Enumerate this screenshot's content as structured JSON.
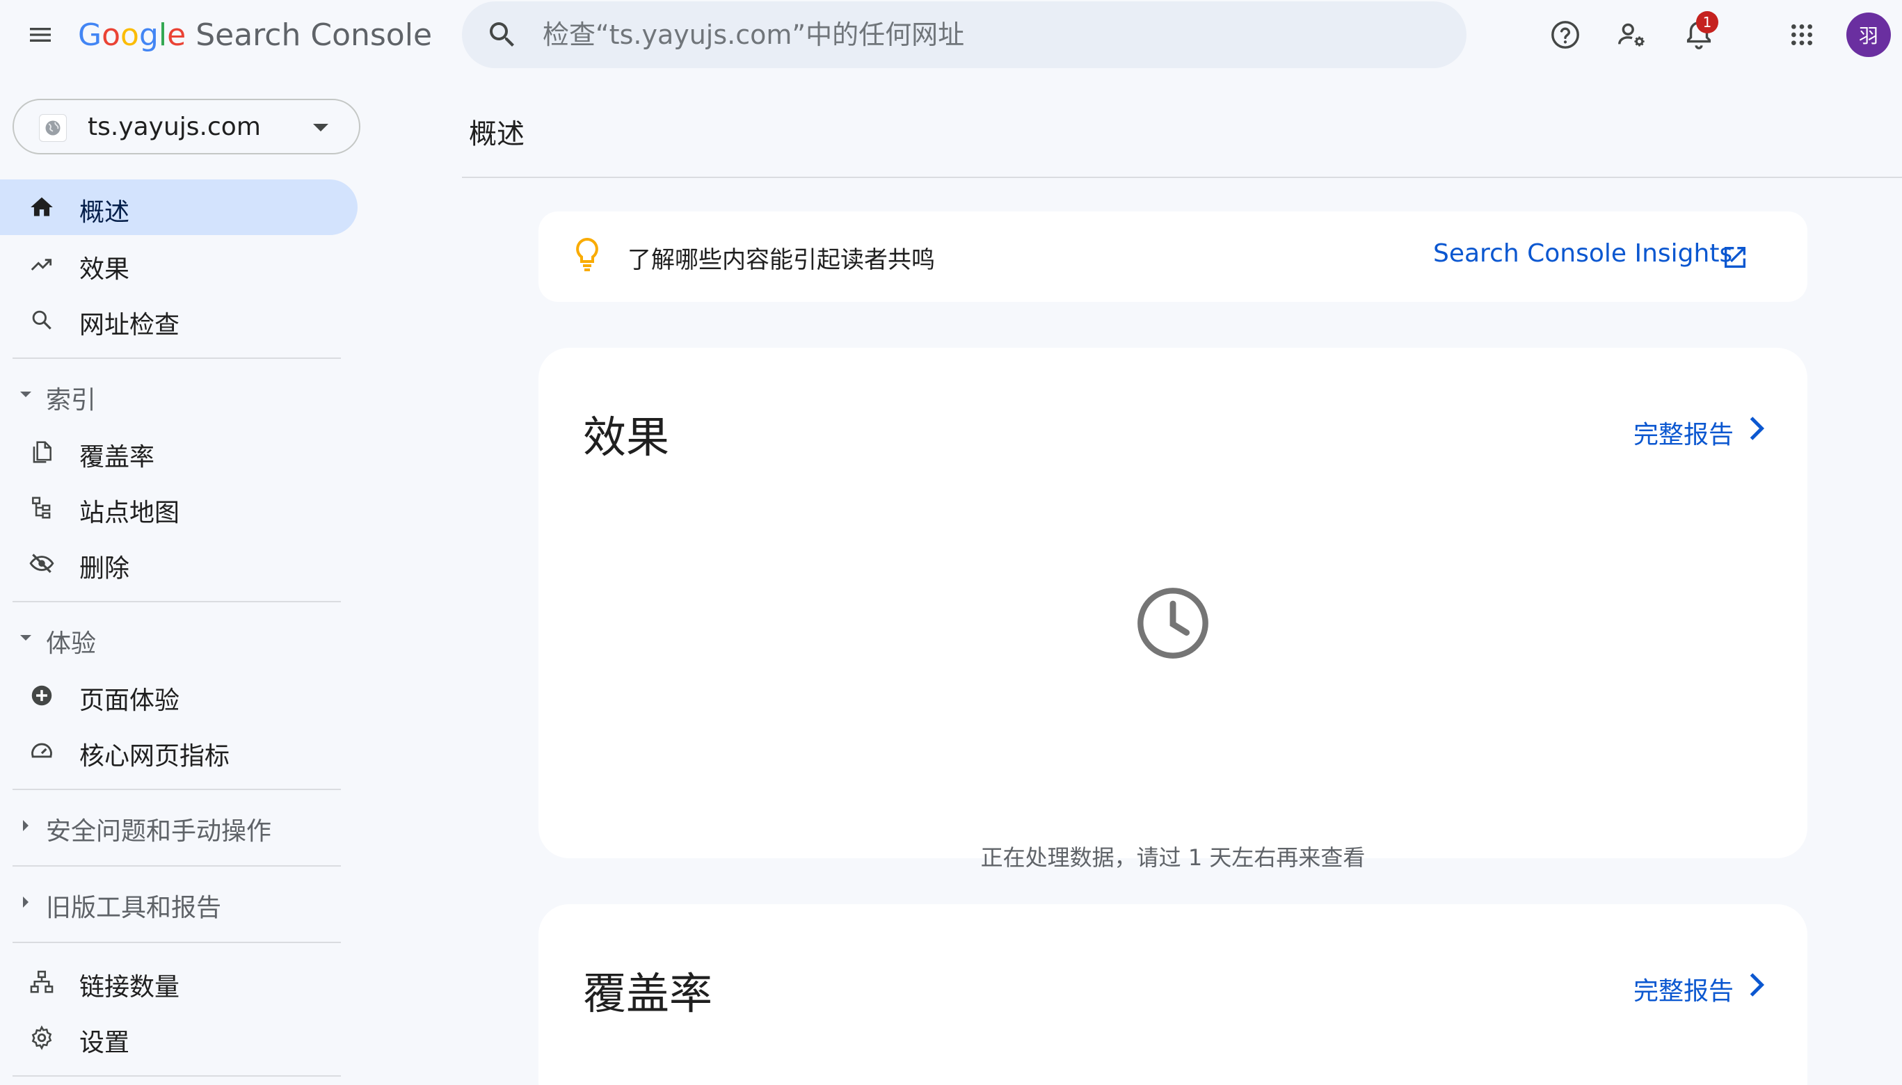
{
  "header": {
    "logo": {
      "g1": "G",
      "o1": "o",
      "o2": "o",
      "g2": "g",
      "l": "l",
      "e": "e",
      "product": "Search Console"
    },
    "search_placeholder": "检查“ts.yayujs.com”中的任何网址",
    "notification_count": "1",
    "avatar_initial": "羽"
  },
  "sidebar": {
    "property": "ts.yayujs.com",
    "items": {
      "overview": "概述",
      "performance": "效果",
      "url_inspection": "网址检查",
      "coverage": "覆盖率",
      "sitemaps": "站点地图",
      "removals": "删除",
      "page_experience": "页面体验",
      "core_web_vitals": "核心网页指标",
      "links": "链接数量",
      "settings": "设置"
    },
    "sections": {
      "index": "索引",
      "experience": "体验",
      "security": "安全问题和手动操作",
      "legacy": "旧版工具和报告"
    }
  },
  "main": {
    "page_title": "概述",
    "insight": {
      "text": "了解哪些内容能引起读者共鸣",
      "link": "Search Console Insights"
    },
    "performance_card": {
      "title": "效果",
      "link": "完整报告",
      "processing": "正在处理数据，请过 1 天左右再来查看"
    },
    "coverage_card": {
      "title": "覆盖率",
      "link": "完整报告"
    }
  },
  "colors": {
    "accent": "#0b57d0",
    "active_nav": "#d3e3fd",
    "badge": "#c5221f",
    "avatar": "#6a2fa0",
    "bulb": "#f9ab00"
  }
}
